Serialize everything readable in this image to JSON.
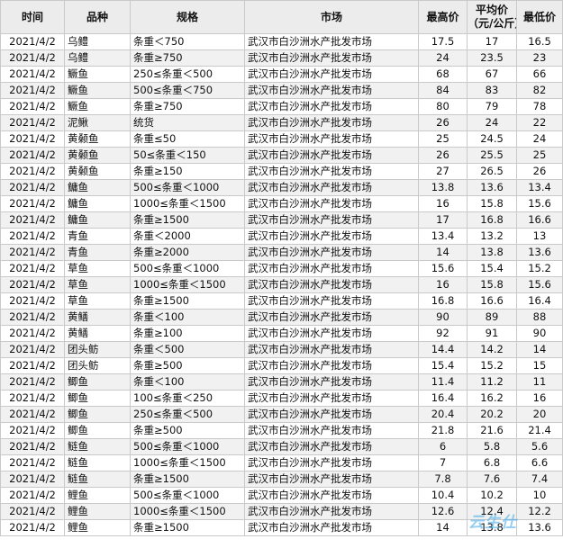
{
  "headers": {
    "date": "时间",
    "name": "品种",
    "spec": "规格",
    "market": "市场",
    "max": "最高价",
    "avg": "平均价",
    "min": "最低价",
    "unit": "（元/公斤）"
  },
  "rows": [
    {
      "date": "2021/4/2",
      "name": "乌鳢",
      "spec": "条重＜750",
      "market": "武汉市白沙洲水产批发市场",
      "max": "17.5",
      "avg": "17",
      "min": "16.5"
    },
    {
      "date": "2021/4/2",
      "name": "乌鳢",
      "spec": "条重≥750",
      "market": "武汉市白沙洲水产批发市场",
      "max": "24",
      "avg": "23.5",
      "min": "23"
    },
    {
      "date": "2021/4/2",
      "name": "鳜鱼",
      "spec": "250≤条重＜500",
      "market": "武汉市白沙洲水产批发市场",
      "max": "68",
      "avg": "67",
      "min": "66"
    },
    {
      "date": "2021/4/2",
      "name": "鳜鱼",
      "spec": "500≤条重＜750",
      "market": "武汉市白沙洲水产批发市场",
      "max": "84",
      "avg": "83",
      "min": "82"
    },
    {
      "date": "2021/4/2",
      "name": "鳜鱼",
      "spec": "条重≥750",
      "market": "武汉市白沙洲水产批发市场",
      "max": "80",
      "avg": "79",
      "min": "78"
    },
    {
      "date": "2021/4/2",
      "name": "泥鳅",
      "spec": "统货",
      "market": "武汉市白沙洲水产批发市场",
      "max": "26",
      "avg": "24",
      "min": "22"
    },
    {
      "date": "2021/4/2",
      "name": "黄颡鱼",
      "spec": "条重≤50",
      "market": "武汉市白沙洲水产批发市场",
      "max": "25",
      "avg": "24.5",
      "min": "24"
    },
    {
      "date": "2021/4/2",
      "name": "黄颡鱼",
      "spec": "50≤条重＜150",
      "market": "武汉市白沙洲水产批发市场",
      "max": "26",
      "avg": "25.5",
      "min": "25"
    },
    {
      "date": "2021/4/2",
      "name": "黄颡鱼",
      "spec": "条重≥150",
      "market": "武汉市白沙洲水产批发市场",
      "max": "27",
      "avg": "26.5",
      "min": "26"
    },
    {
      "date": "2021/4/2",
      "name": "鳙鱼",
      "spec": "500≤条重＜1000",
      "market": "武汉市白沙洲水产批发市场",
      "max": "13.8",
      "avg": "13.6",
      "min": "13.4"
    },
    {
      "date": "2021/4/2",
      "name": "鳙鱼",
      "spec": "1000≤条重＜1500",
      "market": "武汉市白沙洲水产批发市场",
      "max": "16",
      "avg": "15.8",
      "min": "15.6"
    },
    {
      "date": "2021/4/2",
      "name": "鳙鱼",
      "spec": "条重≥1500",
      "market": "武汉市白沙洲水产批发市场",
      "max": "17",
      "avg": "16.8",
      "min": "16.6"
    },
    {
      "date": "2021/4/2",
      "name": "青鱼",
      "spec": "条重＜2000",
      "market": "武汉市白沙洲水产批发市场",
      "max": "13.4",
      "avg": "13.2",
      "min": "13"
    },
    {
      "date": "2021/4/2",
      "name": "青鱼",
      "spec": "条重≥2000",
      "market": "武汉市白沙洲水产批发市场",
      "max": "14",
      "avg": "13.8",
      "min": "13.6"
    },
    {
      "date": "2021/4/2",
      "name": "草鱼",
      "spec": "500≤条重＜1000",
      "market": "武汉市白沙洲水产批发市场",
      "max": "15.6",
      "avg": "15.4",
      "min": "15.2"
    },
    {
      "date": "2021/4/2",
      "name": "草鱼",
      "spec": "1000≤条重＜1500",
      "market": "武汉市白沙洲水产批发市场",
      "max": "16",
      "avg": "15.8",
      "min": "15.6"
    },
    {
      "date": "2021/4/2",
      "name": "草鱼",
      "spec": "条重≥1500",
      "market": "武汉市白沙洲水产批发市场",
      "max": "16.8",
      "avg": "16.6",
      "min": "16.4"
    },
    {
      "date": "2021/4/2",
      "name": "黄鳝",
      "spec": "条重＜100",
      "market": "武汉市白沙洲水产批发市场",
      "max": "90",
      "avg": "89",
      "min": "88"
    },
    {
      "date": "2021/4/2",
      "name": "黄鳝",
      "spec": "条重≥100",
      "market": "武汉市白沙洲水产批发市场",
      "max": "92",
      "avg": "91",
      "min": "90"
    },
    {
      "date": "2021/4/2",
      "name": "团头鲂",
      "spec": "条重＜500",
      "market": "武汉市白沙洲水产批发市场",
      "max": "14.4",
      "avg": "14.2",
      "min": "14"
    },
    {
      "date": "2021/4/2",
      "name": "团头鲂",
      "spec": "条重≥500",
      "market": "武汉市白沙洲水产批发市场",
      "max": "15.4",
      "avg": "15.2",
      "min": "15"
    },
    {
      "date": "2021/4/2",
      "name": "鲫鱼",
      "spec": "条重＜100",
      "market": "武汉市白沙洲水产批发市场",
      "max": "11.4",
      "avg": "11.2",
      "min": "11"
    },
    {
      "date": "2021/4/2",
      "name": "鲫鱼",
      "spec": "100≤条重＜250",
      "market": "武汉市白沙洲水产批发市场",
      "max": "16.4",
      "avg": "16.2",
      "min": "16"
    },
    {
      "date": "2021/4/2",
      "name": "鲫鱼",
      "spec": "250≤条重＜500",
      "market": "武汉市白沙洲水产批发市场",
      "max": "20.4",
      "avg": "20.2",
      "min": "20"
    },
    {
      "date": "2021/4/2",
      "name": "鲫鱼",
      "spec": "条重≥500",
      "market": "武汉市白沙洲水产批发市场",
      "max": "21.8",
      "avg": "21.6",
      "min": "21.4"
    },
    {
      "date": "2021/4/2",
      "name": "鲢鱼",
      "spec": "500≤条重＜1000",
      "market": "武汉市白沙洲水产批发市场",
      "max": "6",
      "avg": "5.8",
      "min": "5.6"
    },
    {
      "date": "2021/4/2",
      "name": "鲢鱼",
      "spec": "1000≤条重＜1500",
      "market": "武汉市白沙洲水产批发市场",
      "max": "7",
      "avg": "6.8",
      "min": "6.6"
    },
    {
      "date": "2021/4/2",
      "name": "鲢鱼",
      "spec": "条重≥1500",
      "market": "武汉市白沙洲水产批发市场",
      "max": "7.8",
      "avg": "7.6",
      "min": "7.4"
    },
    {
      "date": "2021/4/2",
      "name": "鲤鱼",
      "spec": "500≤条重＜1000",
      "market": "武汉市白沙洲水产批发市场",
      "max": "10.4",
      "avg": "10.2",
      "min": "10"
    },
    {
      "date": "2021/4/2",
      "name": "鲤鱼",
      "spec": "1000≤条重＜1500",
      "market": "武汉市白沙洲水产批发市场",
      "max": "12.6",
      "avg": "12.4",
      "min": "12.2"
    },
    {
      "date": "2021/4/2",
      "name": "鲤鱼",
      "spec": "条重≥1500",
      "market": "武汉市白沙洲水产批发市场",
      "max": "14",
      "avg": "13.8",
      "min": "13.6"
    }
  ],
  "watermark": "云生仕"
}
